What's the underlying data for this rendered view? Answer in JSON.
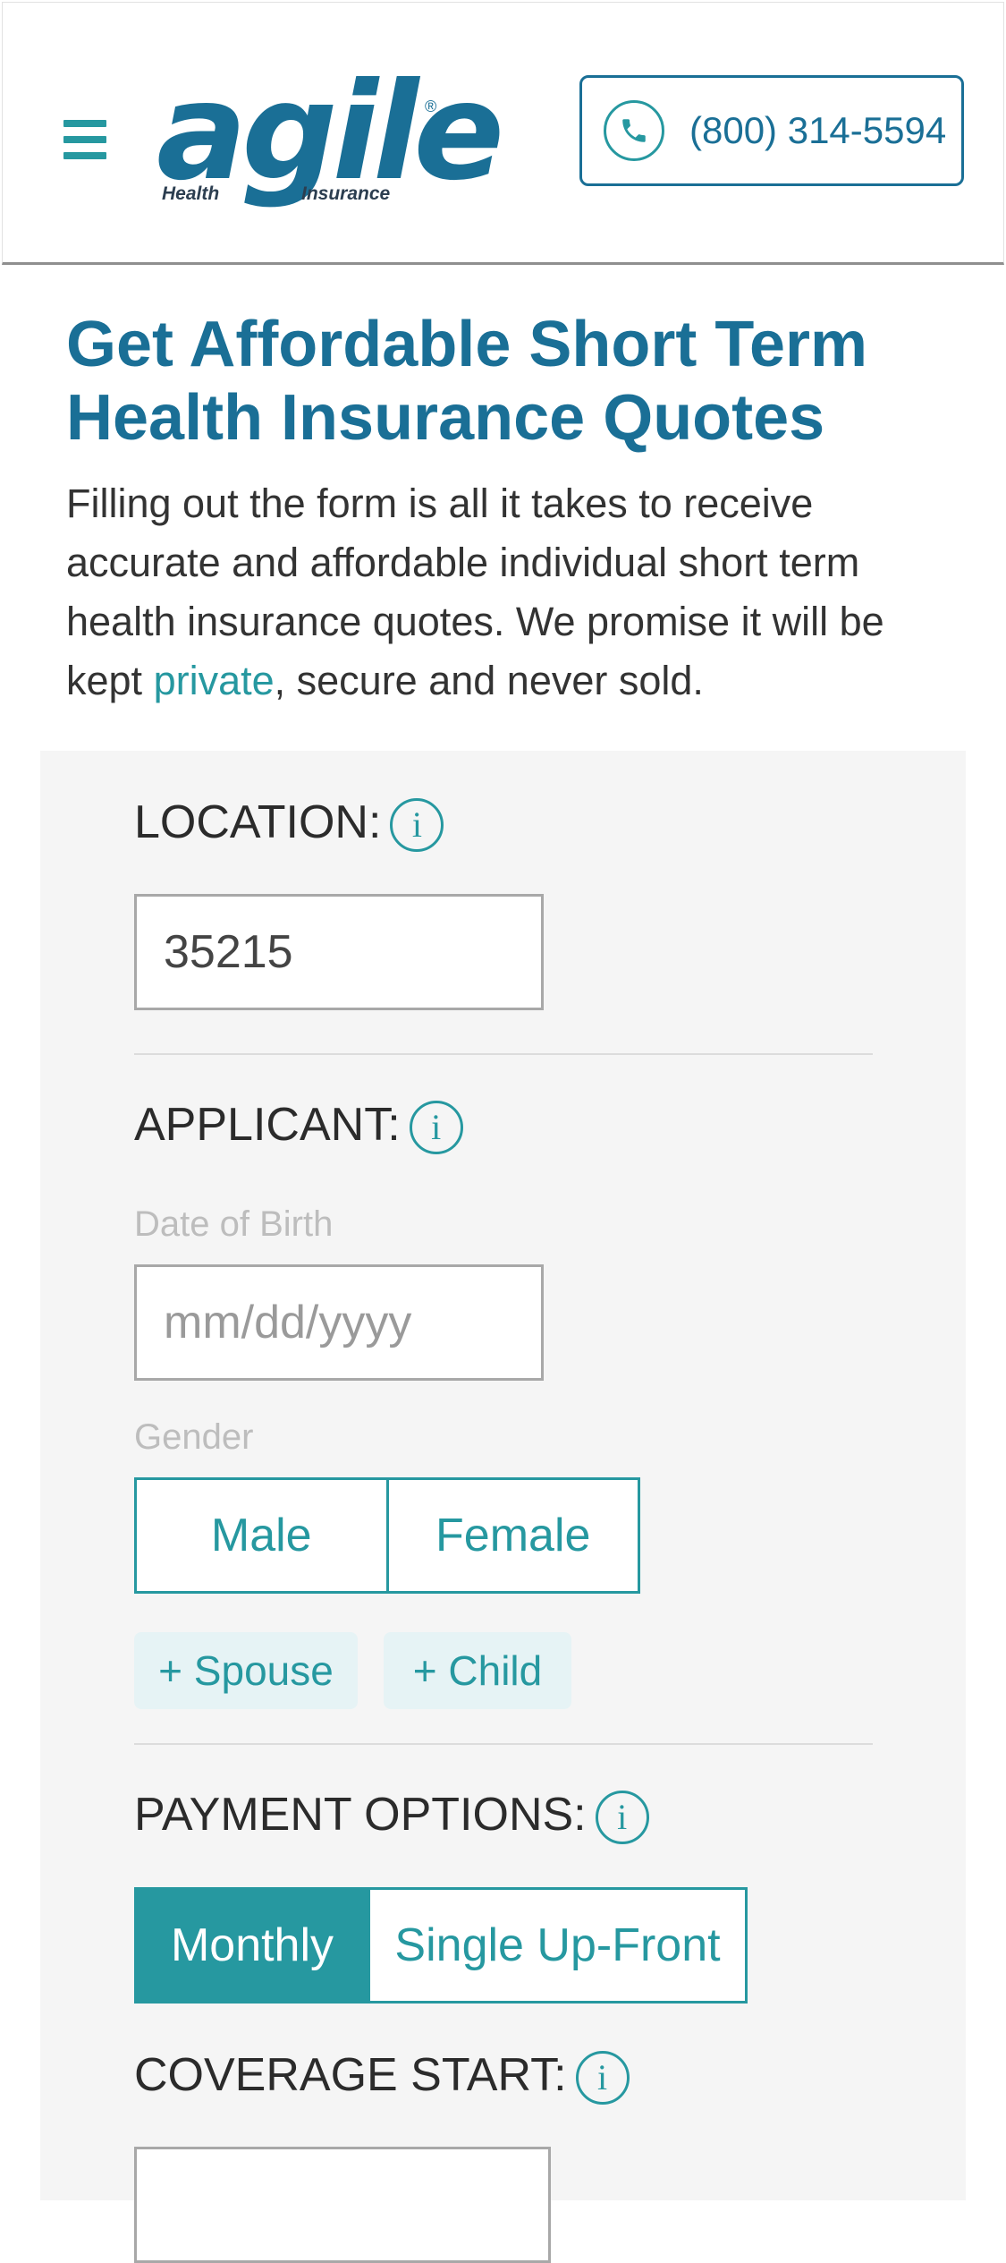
{
  "header": {
    "logo": {
      "word": "agile",
      "health": "Health",
      "insurance": "Insurance",
      "reg": "®"
    },
    "phone": "(800) 314-5594"
  },
  "hero": {
    "title_line1": "Get Affordable Short Term",
    "title_line2": "Health Insurance Quotes",
    "intro_before": "Filling out the form is all it takes to receive accurate and affordable individual short term health insurance quotes. We promise it will be kept ",
    "intro_link": "private",
    "intro_after": ", secure and never sold."
  },
  "form": {
    "location": {
      "label": "LOCATION:",
      "value": "35215"
    },
    "applicant": {
      "label": "APPLICANT:",
      "dob_label": "Date of Birth",
      "dob_placeholder": "mm/dd/yyyy",
      "gender_label": "Gender",
      "gender_options": [
        "Male",
        "Female"
      ],
      "add_spouse": "+ Spouse",
      "add_child": "+ Child"
    },
    "payment": {
      "label": "PAYMENT OPTIONS:",
      "options": [
        "Monthly",
        "Single Up-Front"
      ],
      "selected": "Monthly"
    },
    "coverage": {
      "label": "COVERAGE START:"
    },
    "info_glyph": "i"
  },
  "colors": {
    "brand_blue": "#1a6f96",
    "accent_teal": "#2698a0",
    "panel_bg": "#f5f5f5"
  },
  "icons": [
    "hamburger-menu-icon",
    "phone-icon",
    "info-icon"
  ]
}
